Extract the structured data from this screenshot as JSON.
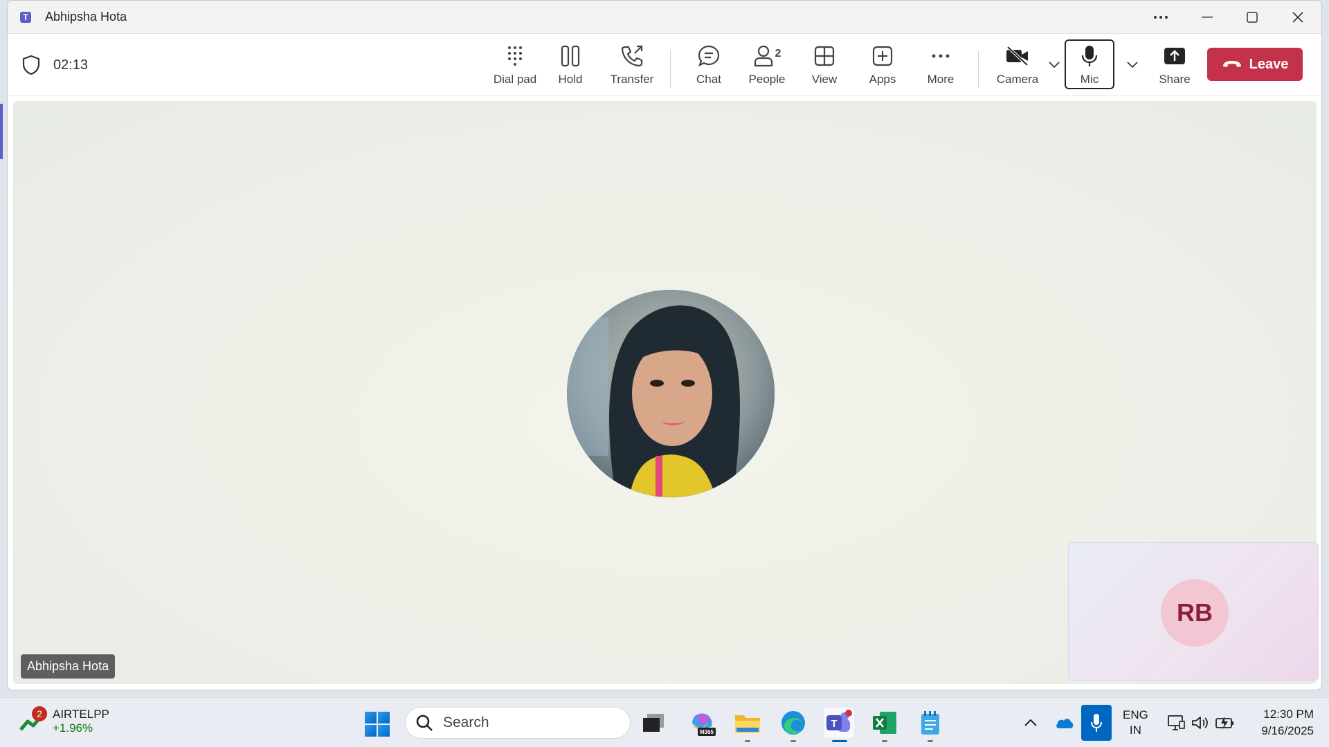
{
  "window": {
    "title": "Abhipsha Hota",
    "icons": {
      "app": "teams-logo-icon",
      "more": "more-horizontal-icon",
      "minimize": "minimize-icon",
      "maximize": "maximize-icon",
      "close": "close-icon"
    }
  },
  "call": {
    "timer": "02:13",
    "buttons": {
      "dial_pad": "Dial pad",
      "hold": "Hold",
      "transfer": "Transfer",
      "chat": "Chat",
      "people": "People",
      "people_count": "2",
      "view": "View",
      "apps": "Apps",
      "more": "More",
      "camera": "Camera",
      "mic": "Mic",
      "share": "Share",
      "leave": "Leave"
    },
    "leave_color": "#c4314b"
  },
  "stage": {
    "participant_name": "Abhipsha Hota",
    "self_initials": "RB"
  },
  "taskbar": {
    "stock": {
      "name": "AIRTELPP",
      "change": "+1.96%",
      "badge": "2"
    },
    "search_placeholder": "Search",
    "language": {
      "line1": "ENG",
      "line2": "IN"
    },
    "time": "12:30 PM",
    "date": "9/16/2025",
    "apps": [
      "task-view-icon",
      "m365-copilot-icon",
      "file-explorer-icon",
      "edge-icon",
      "teams-icon",
      "excel-icon",
      "notepad-icon"
    ]
  }
}
